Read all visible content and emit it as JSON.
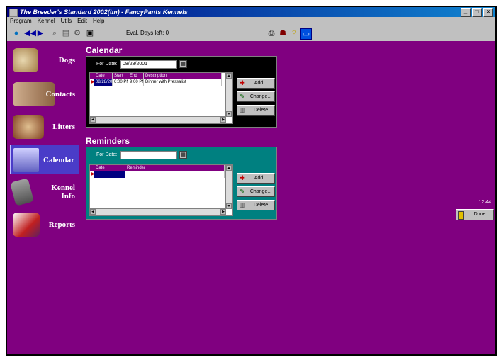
{
  "window": {
    "title": "The Breeder's Standard 2002(tm) - FancyPants Kennels",
    "controls": [
      "_",
      "□",
      "×"
    ]
  },
  "menu": [
    "Program",
    "Kennel",
    "Utils",
    "Edit",
    "Help"
  ],
  "toolbar": {
    "days_left": "Eval. Days left: 0"
  },
  "nav": [
    {
      "label": "Dogs"
    },
    {
      "label": "Contacts"
    },
    {
      "label": "Litters"
    },
    {
      "label": "Calendar",
      "active": true
    },
    {
      "label": "Kennel Info"
    },
    {
      "label": "Reports"
    }
  ],
  "calendar": {
    "title": "Calendar",
    "for_date_label": "For Date:",
    "date_value": "08/28/2001",
    "columns": [
      "Date",
      "Start",
      "End",
      "Description"
    ],
    "rows": [
      {
        "date": "08/28/2001",
        "start": "6:00 PM",
        "end": "9:00 PM",
        "description": "Dinner with Pressalist"
      }
    ],
    "buttons": {
      "add": "Add...",
      "change": "Change...",
      "delete": "Delete"
    }
  },
  "reminders": {
    "title": "Reminders",
    "for_date_label": "For Date:",
    "date_value": "",
    "columns": [
      "Date",
      "Reminder"
    ],
    "buttons": {
      "add": "Add...",
      "change": "Change...",
      "delete": "Delete"
    }
  },
  "status": {
    "clock": "12:44",
    "done_label": "Done"
  },
  "colors": {
    "background": "#800080",
    "calendar_panel": "#000000",
    "reminders_panel": "#008080"
  }
}
